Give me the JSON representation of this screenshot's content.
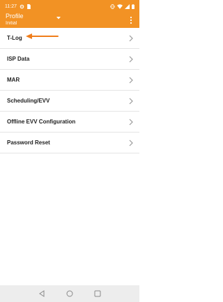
{
  "status_bar": {
    "time": "11:27"
  },
  "app_bar": {
    "title": "Profile",
    "subtitle": "Initial",
    "dropdown_icon": "caret-down-icon",
    "menu_icon": "overflow-menu-icon"
  },
  "menu": {
    "items": [
      {
        "label": "T-Log"
      },
      {
        "label": "ISP Data"
      },
      {
        "label": "MAR"
      },
      {
        "label": "Scheduling/EVV"
      },
      {
        "label": "Offline EVV Configuration"
      },
      {
        "label": "Password Reset"
      }
    ]
  },
  "colors": {
    "accent": "#f29224",
    "annotation": "#f07d1a",
    "divider": "#e4e4e4",
    "chevron": "#9a9a9a",
    "nav_bar": "#ededed"
  }
}
